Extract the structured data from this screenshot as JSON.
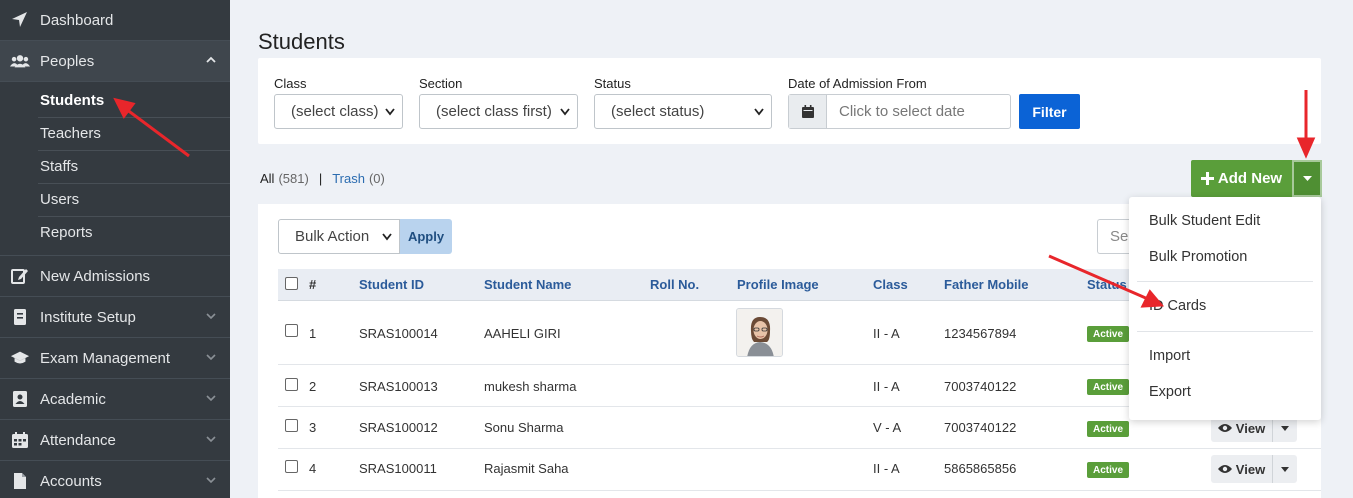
{
  "sidebar": {
    "items": [
      {
        "label": "Dashboard",
        "icon": "paper-plane-icon"
      },
      {
        "label": "Peoples",
        "icon": "users-icon"
      },
      {
        "label": "New Admissions",
        "icon": "edit-icon"
      },
      {
        "label": "Institute Setup",
        "icon": "book-icon"
      },
      {
        "label": "Exam Management",
        "icon": "graduation-cap-icon"
      },
      {
        "label": "Academic",
        "icon": "contact-book-icon"
      },
      {
        "label": "Attendance",
        "icon": "calendar-icon"
      },
      {
        "label": "Accounts",
        "icon": "file-icon"
      }
    ],
    "peoples_sub": [
      "Students",
      "Teachers",
      "Staffs",
      "Users",
      "Reports"
    ]
  },
  "page": {
    "title": "Students"
  },
  "filters": {
    "class_label": "Class",
    "class_value": "(select class)",
    "section_label": "Section",
    "section_value": "(select class first)",
    "status_label": "Status",
    "status_value": "(select status)",
    "date_label": "Date of Admission From",
    "date_placeholder": "Click to select date",
    "filter_button": "Filter"
  },
  "tabs": {
    "all": "All",
    "all_count": "(581)",
    "separator": "|",
    "trash": "Trash",
    "trash_count": "(0)"
  },
  "toolbar": {
    "add_new": "Add New",
    "bulk_action": "Bulk Action",
    "apply": "Apply",
    "search_placeholder": "Search"
  },
  "table": {
    "headers": {
      "num": "#",
      "student_id": "Student ID",
      "student_name": "Student Name",
      "roll": "Roll No.",
      "profile": "Profile Image",
      "class": "Class",
      "father_mobile": "Father Mobile",
      "status": "Status"
    },
    "rows": [
      {
        "num": "1",
        "student_id": "SRAS100014",
        "name": "AAHELI GIRI",
        "roll": "",
        "class": "II - A",
        "mobile": "1234567894",
        "status": "Active"
      },
      {
        "num": "2",
        "student_id": "SRAS100013",
        "name": "mukesh sharma",
        "roll": "",
        "class": "II - A",
        "mobile": "7003740122",
        "status": "Active"
      },
      {
        "num": "3",
        "student_id": "SRAS100012",
        "name": "Sonu Sharma",
        "roll": "",
        "class": "V - A",
        "mobile": "7003740122",
        "status": "Active"
      },
      {
        "num": "4",
        "student_id": "SRAS100011",
        "name": "Rajasmit Saha",
        "roll": "",
        "class": "II - A",
        "mobile": "5865865856",
        "status": "Active"
      }
    ],
    "view_label": "View"
  },
  "dropdown": {
    "items": [
      "Bulk Student Edit",
      "Bulk Promotion",
      "ID Cards",
      "Import",
      "Export"
    ]
  },
  "colors": {
    "sidebar_bg": "#343a40",
    "primary": "#0b63d6",
    "success": "#5a9e3a",
    "annotation_arrow": "#e8262b"
  }
}
